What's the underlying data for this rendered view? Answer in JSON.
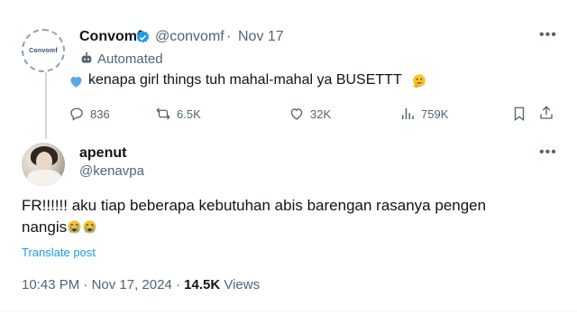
{
  "original_tweet": {
    "avatar_text": "Convomf",
    "display_name": "Convomf",
    "handle": "@convomf",
    "separator": "·",
    "date": "Nov 17",
    "automated_label": "Automated",
    "text": "kenapa girl things tuh mahal-mahal ya BUSETTT",
    "stats": {
      "replies": "836",
      "retweets": "6.5K",
      "likes": "32K",
      "views": "759K"
    }
  },
  "reply_tweet": {
    "display_name": "apenut",
    "handle": "@kenavpa",
    "text_line": "FR!!!!!! aku tiap beberapa kebutuhan abis barengan rasanya pengen nangis",
    "translate_label": "Translate post",
    "time": "10:43 PM",
    "date": "Nov 17, 2024",
    "views_count": "14.5K",
    "views_label": "Views"
  },
  "icons": {
    "more": "more-icon",
    "verified": "verified-badge-icon",
    "bot": "bot-icon",
    "heart": "blue-heart-icon",
    "emoji": "thinking-face-emoji",
    "reply": "reply-icon",
    "retweet": "retweet-icon",
    "like": "like-icon",
    "views": "views-icon",
    "bookmark": "bookmark-icon",
    "share": "share-icon",
    "cry": "crying-face-emoji"
  },
  "colors": {
    "accent": "#1d9bf0",
    "secondary_text": "#536471",
    "primary_text": "#0f1419"
  }
}
